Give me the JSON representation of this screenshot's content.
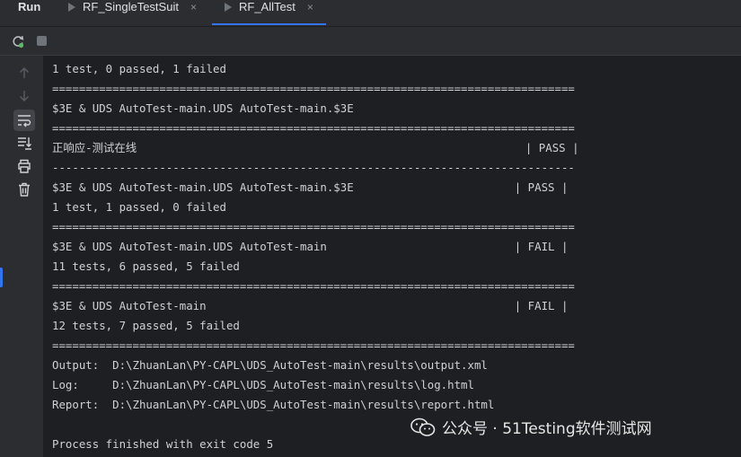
{
  "run_label": "Run",
  "tabs": [
    {
      "label": "RF_SingleTestSuit",
      "close": "×"
    },
    {
      "label": "RF_AllTest",
      "close": "×"
    }
  ],
  "console_lines": [
    "1 test, 0 passed, 1 failed",
    "==============================================================================",
    "$3E & UDS AutoTest-main.UDS AutoTest-main.$3E",
    "==============================================================================",
    "正响应-测试在线                                                          | PASS |",
    "------------------------------------------------------------------------------",
    "$3E & UDS AutoTest-main.UDS AutoTest-main.$3E                        | PASS |",
    "1 test, 1 passed, 0 failed",
    "==============================================================================",
    "$3E & UDS AutoTest-main.UDS AutoTest-main                            | FAIL |",
    "11 tests, 6 passed, 5 failed",
    "==============================================================================",
    "$3E & UDS AutoTest-main                                              | FAIL |",
    "12 tests, 7 passed, 5 failed",
    "==============================================================================",
    "Output:  D:\\ZhuanLan\\PY-CAPL\\UDS_AutoTest-main\\results\\output.xml",
    "Log:     D:\\ZhuanLan\\PY-CAPL\\UDS_AutoTest-main\\results\\log.html",
    "Report:  D:\\ZhuanLan\\PY-CAPL\\UDS_AutoTest-main\\results\\report.html",
    "",
    "Process finished with exit code 5"
  ],
  "watermark": "公众号 · 51Testing软件测试网",
  "colors": {
    "accent": "#3574f0",
    "background": "#1e1f22",
    "panel": "#2b2d30"
  }
}
